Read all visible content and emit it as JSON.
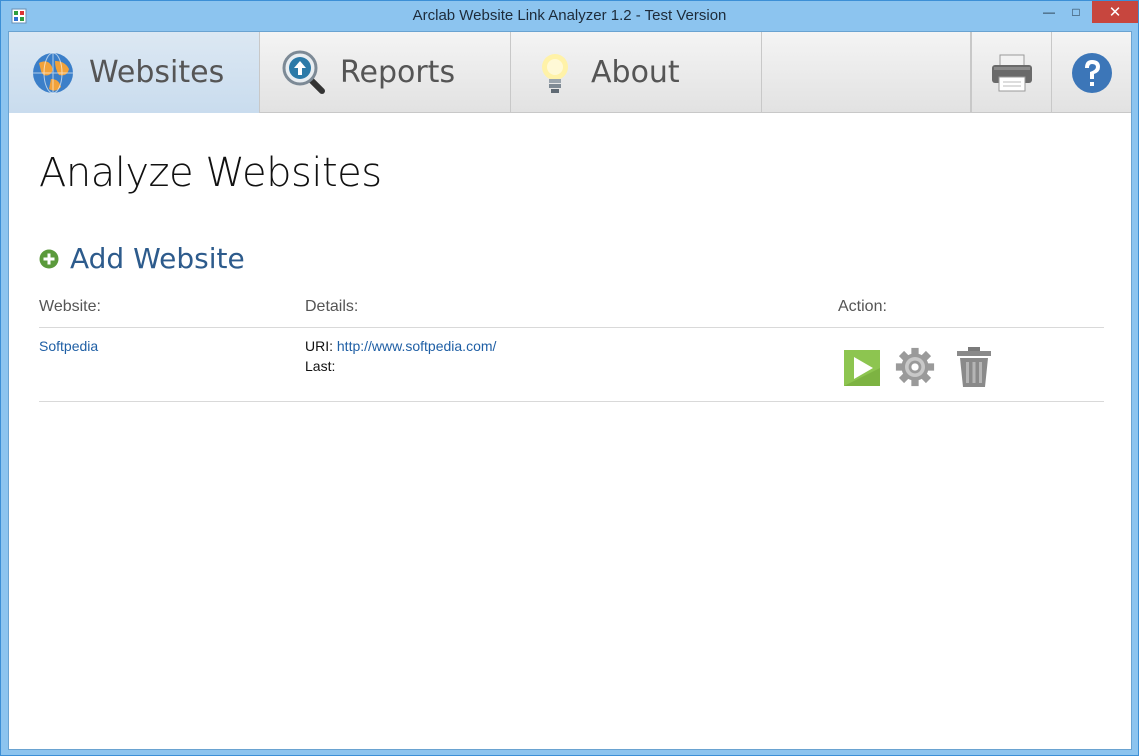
{
  "window": {
    "title": "Arclab Website Link Analyzer 1.2 - Test Version",
    "minimize_glyph": "—",
    "maximize_glyph": "□",
    "close_glyph": "✕"
  },
  "tabs": [
    {
      "label": "Websites",
      "icon": "globe-icon",
      "active": true
    },
    {
      "label": "Reports",
      "icon": "magnifier-icon",
      "active": false
    },
    {
      "label": "About",
      "icon": "lightbulb-icon",
      "active": false
    }
  ],
  "toolbar": {
    "print_icon": "printer-icon",
    "help_icon": "help-icon"
  },
  "page": {
    "title": "Analyze Websites",
    "add_label": "Add Website"
  },
  "table": {
    "headers": {
      "website": "Website:",
      "details": "Details:",
      "action": "Action:"
    },
    "rows": [
      {
        "website": "Softpedia",
        "uri_label": "URI:",
        "uri": "http://www.softpedia.com/",
        "last_label": "Last:",
        "last": ""
      }
    ]
  },
  "colors": {
    "accent": "#2d5b8c",
    "link": "#1f5fa5",
    "titlebar": "#8cc4ef",
    "play": "#8dc550"
  }
}
